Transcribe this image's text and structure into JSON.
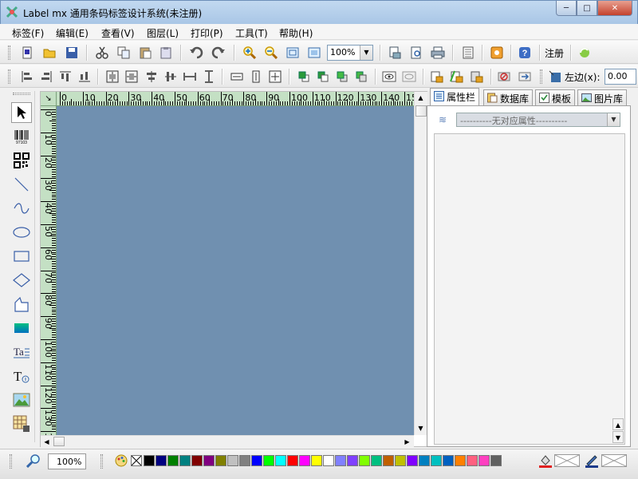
{
  "window": {
    "title": "Label mx 通用条码标签设计系统(未注册)",
    "min_label": "─",
    "max_label": "□",
    "close_label": "✕"
  },
  "menu": [
    "标签(F)",
    "编辑(E)",
    "查看(V)",
    "图层(L)",
    "打印(P)",
    "工具(T)",
    "帮助(H)"
  ],
  "toolbar": {
    "zoom_value": "100%",
    "register_label": "注册",
    "left_margin_label": "左边(x):",
    "left_margin_value": "0.00"
  },
  "ruler": {
    "corner_label": "↘",
    "h_ticks": [
      "0",
      "10",
      "20",
      "30",
      "40",
      "50",
      "60",
      "70",
      "80",
      "90",
      "100",
      "110",
      "120",
      "130",
      "140",
      "150"
    ],
    "v_ticks": [
      "0",
      "10",
      "20",
      "30",
      "40",
      "50",
      "60",
      "70",
      "80",
      "90",
      "100",
      "110",
      "120",
      "130",
      "14"
    ]
  },
  "panel": {
    "tabs": [
      "属性栏",
      "数据库",
      "模板",
      "图片库"
    ],
    "property_placeholder": "----------无对应属性----------"
  },
  "status": {
    "zoom_value": "100%"
  },
  "palette": [
    "#000000",
    "#000080",
    "#008000",
    "#008080",
    "#800000",
    "#800080",
    "#808000",
    "#c0c0c0",
    "#808080",
    "#0000ff",
    "#00ff00",
    "#00ffff",
    "#ff0000",
    "#ff00ff",
    "#ffff00",
    "#ffffff",
    "#8080ff",
    "#8040ff",
    "#80ff00",
    "#00c080",
    "#c06000",
    "#c0c000",
    "#8000ff",
    "#0080c0",
    "#00c0c0",
    "#0060c0",
    "#ff8000",
    "#ff6080",
    "#ff40c0",
    "#606060"
  ],
  "colors": {
    "design_area": "#7090b0",
    "ruler": "#c4e0c4"
  }
}
